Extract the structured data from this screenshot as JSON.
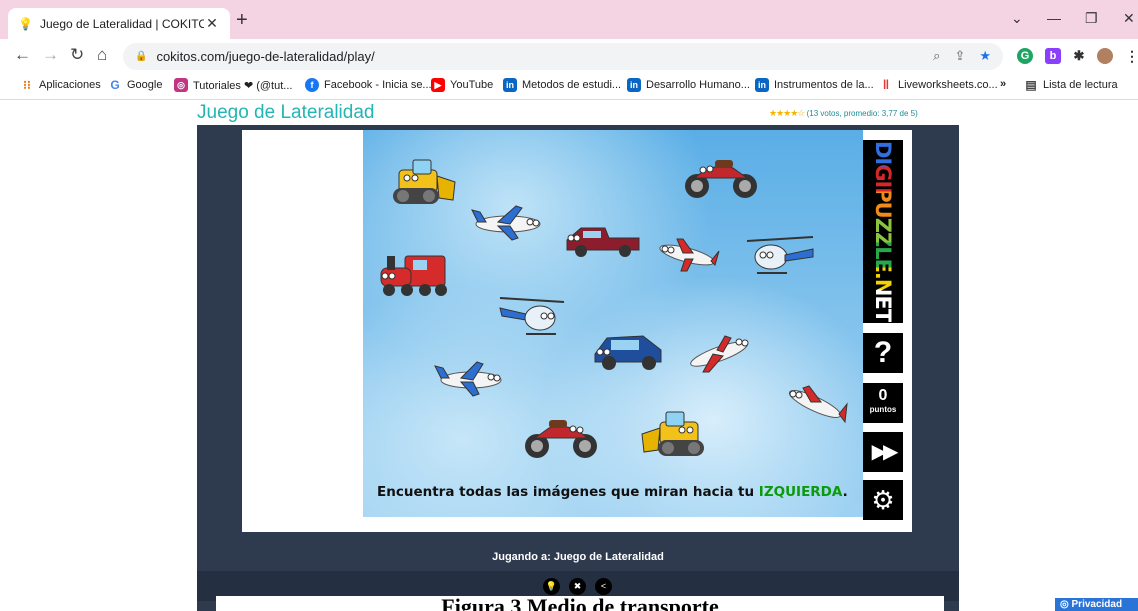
{
  "browser": {
    "tab_title": "Juego de Lateralidad | COKITOS",
    "tab_close": "✕",
    "new_tab": "+",
    "url": "cokitos.com/juego-de-lateralidad/play/",
    "window_controls": [
      "⌄",
      "—",
      "❐",
      "✕"
    ]
  },
  "bookmarks": [
    {
      "label": "Aplicaciones",
      "icon": "apps-grid-icon",
      "color": "#e8710a"
    },
    {
      "label": "Google",
      "icon": "google-icon",
      "color": "#4285f4"
    },
    {
      "label": "Tutoriales ❤ (@tut...",
      "icon": "instagram-icon",
      "color": "#c13584"
    },
    {
      "label": "Facebook - Inicia se...",
      "icon": "facebook-icon",
      "color": "#1877f2"
    },
    {
      "label": "YouTube",
      "icon": "youtube-icon",
      "color": "#ff0000"
    },
    {
      "label": "Metodos de estudi...",
      "icon": "linkedin-icon",
      "color": "#0a66c2"
    },
    {
      "label": "Desarrollo Humano...",
      "icon": "linkedin-icon",
      "color": "#0a66c2"
    },
    {
      "label": "Instrumentos de la...",
      "icon": "linkedin-icon",
      "color": "#0a66c2"
    },
    {
      "label": "Liveworksheets.co...",
      "icon": "liveworksheets-icon",
      "color": "#e53935"
    }
  ],
  "bookmarks_overflow": "»",
  "reading_list": "Lista de lectura",
  "page": {
    "title": "Juego de Lateralidad",
    "rating_stars": "★★★★☆",
    "rating_text": "(13 votos, promedio: 3,77 de 5)",
    "rating_votes": "13",
    "rating_avg": "3,77"
  },
  "game": {
    "instruction_prefix": "Encuentra todas las imágenes que miran hacia tu ",
    "instruction_keyword": "IZQUIERDA",
    "instruction_suffix": ".",
    "logo_text": "DIGIPUZZLE.NET",
    "help_label": "?",
    "points_value": "0",
    "points_label": "puntos",
    "skip_label": "▶▶",
    "settings_label": "⚙",
    "playing_label": "Jugando a: Juego de Lateralidad",
    "sprites": [
      {
        "kind": "bulldozer",
        "faces": "left"
      },
      {
        "kind": "motorcycle",
        "faces": "left"
      },
      {
        "kind": "airplane",
        "faces": "right"
      },
      {
        "kind": "pickup-truck",
        "faces": "left"
      },
      {
        "kind": "airplane",
        "faces": "left"
      },
      {
        "kind": "helicopter",
        "faces": "left"
      },
      {
        "kind": "train",
        "faces": "left"
      },
      {
        "kind": "helicopter",
        "faces": "right"
      },
      {
        "kind": "car",
        "faces": "left"
      },
      {
        "kind": "airplane",
        "faces": "right"
      },
      {
        "kind": "airplane",
        "faces": "right"
      },
      {
        "kind": "airplane",
        "faces": "left"
      },
      {
        "kind": "motorcycle",
        "faces": "right"
      },
      {
        "kind": "bulldozer",
        "faces": "right"
      }
    ]
  },
  "controls": [
    "💡",
    "✖",
    "<"
  ],
  "caption": "Figura 3 Medio de transporte",
  "privacy": "◎ Privacidad",
  "colors": {
    "title_teal": "#24b5b4",
    "frame_navy": "#2e3b4e",
    "keyword_green": "#0a9a0a",
    "tab_strip_pink": "#f4d3e3"
  }
}
